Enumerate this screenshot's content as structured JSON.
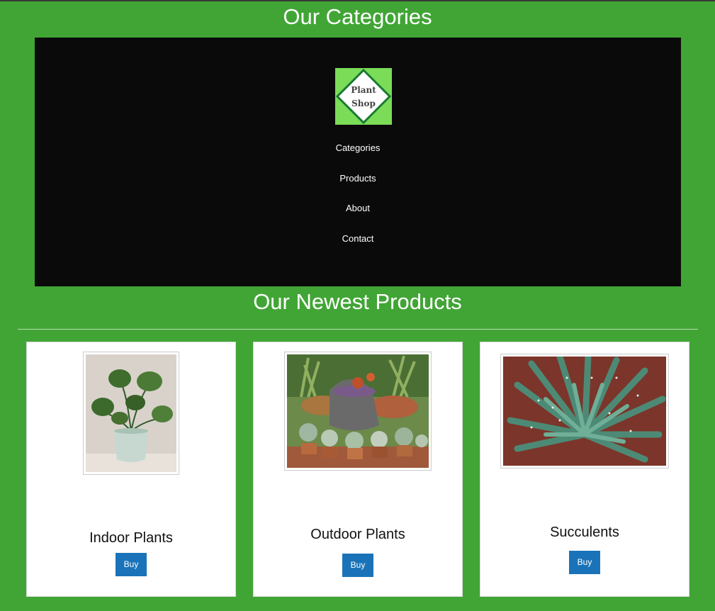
{
  "header": {
    "categories_title": "Our Categories",
    "newest_title": "Our Newest Products"
  },
  "logo": {
    "line1": "Plant",
    "line2": "Shop"
  },
  "nav": {
    "items": [
      {
        "label": "Categories"
      },
      {
        "label": "Products"
      },
      {
        "label": "About"
      },
      {
        "label": "Contact"
      }
    ]
  },
  "products": [
    {
      "name": "Indoor Plants",
      "buy_label": "Buy",
      "image": "monstera-in-pot-image"
    },
    {
      "name": "Outdoor Plants",
      "buy_label": "Buy",
      "image": "outdoor-succulent-garden-image"
    },
    {
      "name": "Succulents",
      "buy_label": "Buy",
      "image": "aloe-succulent-image"
    }
  ],
  "colors": {
    "page_background": "#41a535",
    "nav_background": "#0a0a0b",
    "logo_background": "#7bdc58",
    "logo_border": "#1a7a32",
    "buy_button": "#1a73b8"
  }
}
